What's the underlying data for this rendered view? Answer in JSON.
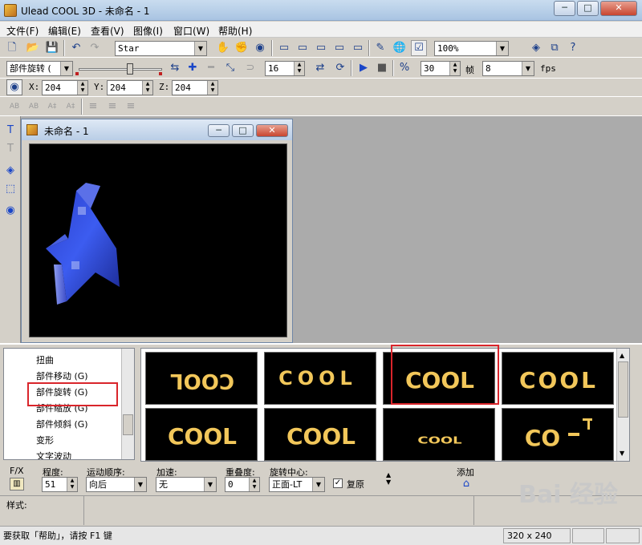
{
  "window": {
    "title": "Ulead COOL 3D - 未命名 - 1"
  },
  "menu": [
    "文件(F)",
    "编辑(E)",
    "查看(V)",
    "图像(I)",
    "窗口(W)",
    "帮助(H)"
  ],
  "toolbar": {
    "font_combo": "Star",
    "zoom_combo": "100%"
  },
  "animbar": {
    "object_combo": "部件旋转  (",
    "frame_value": "16",
    "total_frames": "30",
    "frames_label": "帧",
    "fps_value": "8",
    "fps_label": "fps"
  },
  "xyz": {
    "x_label": "X:",
    "x_value": "204",
    "y_label": "Y:",
    "y_value": "204",
    "z_label": "Z:",
    "z_value": "204"
  },
  "child": {
    "title": "未命名 - 1"
  },
  "effects_tree": [
    "扭曲",
    "部件移动 (G)",
    "部件旋转 (G)",
    "部件缩放 (G)",
    "部件倾斜 (G)",
    "变形",
    "文字波动"
  ],
  "gallery": {
    "thumbs": [
      "COOL",
      "COOL",
      "COOL",
      "COOL",
      "COOL",
      "COOL",
      "COOL",
      "CO"
    ]
  },
  "props": {
    "fx_label": "F/X",
    "degree_label": "程度:",
    "degree_value": "51",
    "order_label": "运动顺序:",
    "order_value": "向后",
    "accel_label": "加速:",
    "accel_value": "无",
    "overlap_label": "重叠度:",
    "overlap_value": "0",
    "center_label": "旋转中心:",
    "center_value": "正面-LT",
    "restore_label": "复原",
    "add_label": "添加"
  },
  "style": {
    "label": "样式:"
  },
  "status": {
    "hint": "要获取「帮助」，请按 F1 键",
    "size": "320 x 240"
  },
  "watermark": "Bai 经验",
  "colors": {
    "highlight": "#d9252b",
    "cool_gold": "#f2c75a"
  }
}
